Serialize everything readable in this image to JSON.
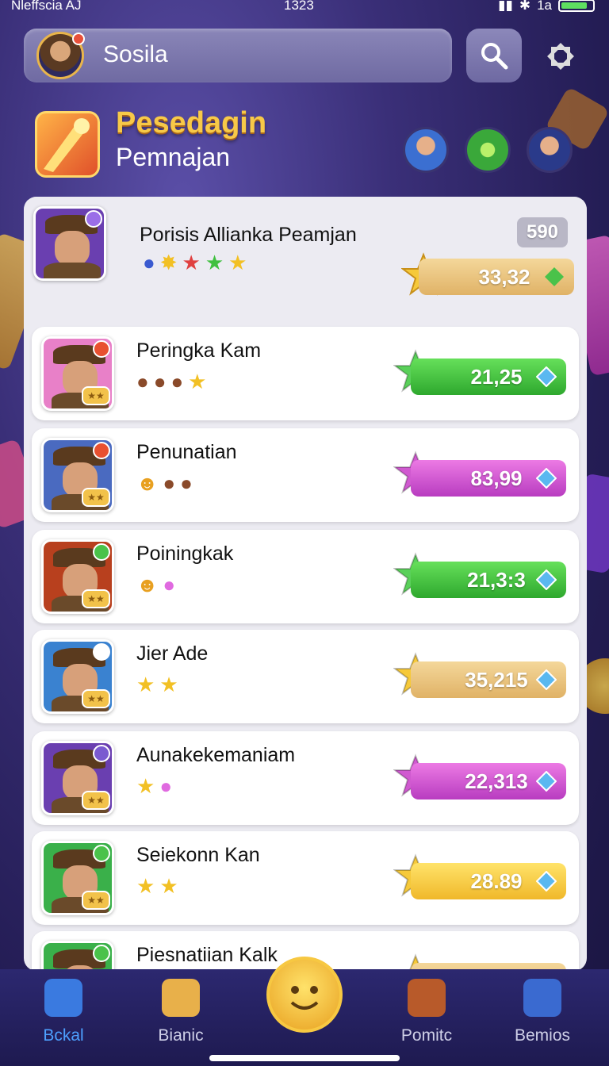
{
  "status_bar": {
    "carrier": "Nleffscia AJ",
    "time": "1323",
    "battery_label": "1a"
  },
  "search": {
    "value": "Sosila"
  },
  "header": {
    "title": "Pesedagin",
    "subtitle": "Pemnajan"
  },
  "top_entry": {
    "name": "Porisis Allianka Peamjan",
    "rank": "590",
    "score": "33,32"
  },
  "rows": [
    {
      "name": "Peringka Kam",
      "score": "21,25",
      "color": "green"
    },
    {
      "name": "Penunatian",
      "score": "83,99",
      "color": "purple"
    },
    {
      "name": "Poiningkak",
      "score": "21,3:3",
      "color": "green"
    },
    {
      "name": "Jier Ade",
      "score": "35,215",
      "color": "gold"
    },
    {
      "name": "Aunakekemaniam",
      "score": "22,313",
      "color": "purple"
    },
    {
      "name": "Seiekonn Kan",
      "score": "28.89",
      "color": "yellow"
    },
    {
      "name": "Piesnatiian Kalk",
      "score": "",
      "color": "gold"
    }
  ],
  "nav": {
    "items": [
      {
        "label": "Bckal",
        "icon": "home-icon"
      },
      {
        "label": "Bianic",
        "icon": "shop-icon"
      },
      {
        "label": "Pomitc",
        "icon": "refresh-icon"
      },
      {
        "label": "Bemios",
        "icon": "profile-icon"
      }
    ]
  },
  "colors": {
    "accent": "#4da0ff",
    "title_gold": "#f7c948",
    "panel": "#ecebf2"
  }
}
